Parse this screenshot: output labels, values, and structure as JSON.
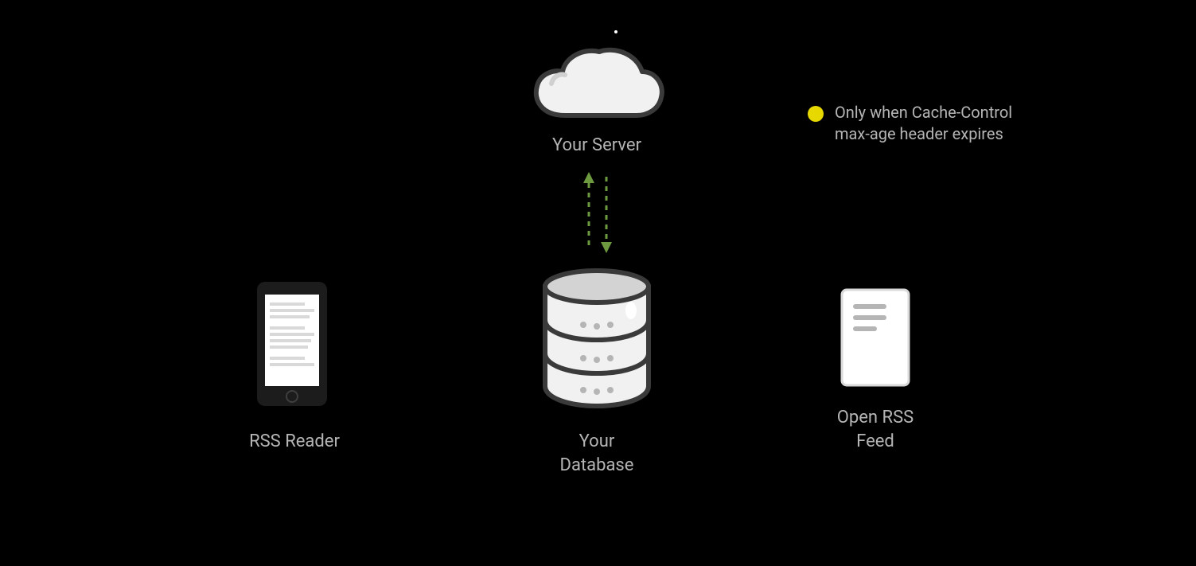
{
  "nodes": {
    "cloud": {
      "label": "Your Server"
    },
    "database": {
      "label": "Your\nDatabase"
    },
    "phone": {
      "label": "RSS Reader"
    },
    "doc": {
      "label": "Open RSS\nFeed"
    }
  },
  "legend": {
    "yellow": {
      "color": "#e7d900",
      "text": "Only when Cache-Control\nmax-age header expires"
    }
  },
  "colors": {
    "label": "#b5b5b5",
    "stroke": "#3a3a3a",
    "arrow": "#6e9a3f",
    "fillLight": "#d3d3d3",
    "fillWhite": "#ffffff"
  }
}
